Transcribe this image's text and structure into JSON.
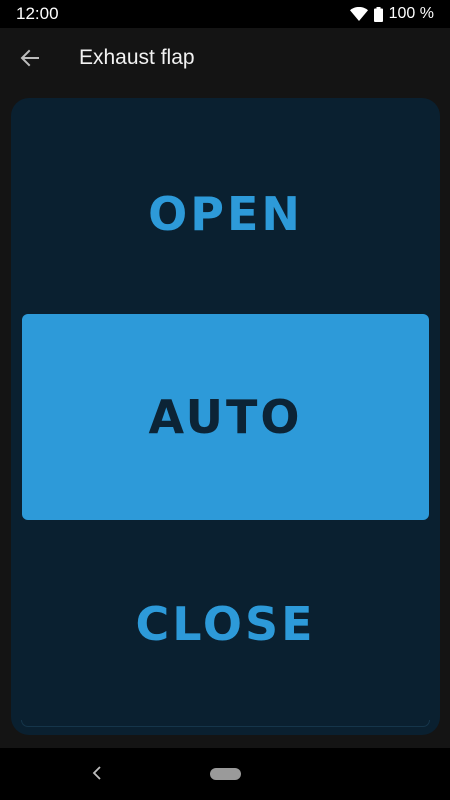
{
  "status_bar": {
    "time": "12:00",
    "battery_percent": "100 %",
    "wifi_icon": "wifi-icon",
    "battery_icon": "battery-full-icon"
  },
  "app_bar": {
    "title": "Exhaust flap",
    "back_icon": "arrow-left-icon"
  },
  "modes": {
    "open_label": "OPEN",
    "auto_label": "AUTO",
    "close_label": "CLOSE",
    "selected": "AUTO"
  },
  "colors": {
    "accent": "#2d9ad9",
    "panel": "#0a2030",
    "background": "#141414"
  },
  "nav_bar": {
    "back_icon": "chevron-left-icon",
    "home_icon": "home-pill-icon"
  }
}
